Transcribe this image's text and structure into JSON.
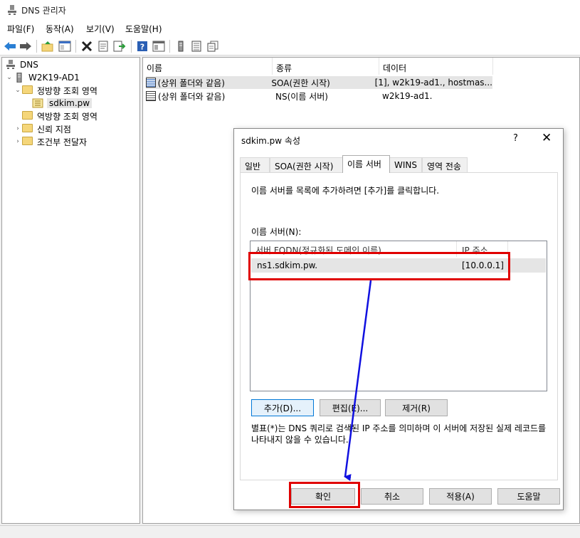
{
  "window": {
    "title": "DNS 관리자"
  },
  "menu": [
    "파일(F)",
    "동작(A)",
    "보기(V)",
    "도움말(H)"
  ],
  "toolbar": {
    "icons": [
      "back-icon",
      "forward-icon",
      "up-folder-icon",
      "console-tree-icon",
      "delete-icon",
      "properties-icon",
      "export-icon",
      "help-icon",
      "view-icon",
      "server-icon",
      "record-icon",
      "copy-icon"
    ]
  },
  "tree": {
    "root": "DNS",
    "server": "W2K19-AD1",
    "forward_zones": "정방향 조회 영역",
    "zone": "sdkim.pw",
    "reverse_zones": "역방향 조회 영역",
    "trust_points": "신뢰 지점",
    "conditional_forwarders": "조건부 전달자"
  },
  "list": {
    "columns": [
      "이름",
      "종류",
      "데이터"
    ],
    "rows": [
      {
        "name": "(상위 폴더와 같음)",
        "type": "SOA(권한 시작)",
        "data": "[1], w2k19-ad1., hostmas..."
      },
      {
        "name": "(상위 폴더와 같음)",
        "type": "NS(이름 서버)",
        "data": "w2k19-ad1."
      }
    ]
  },
  "dialog": {
    "title": "sdkim.pw 속성",
    "help": "?",
    "close": "✕",
    "tabs": [
      "일반",
      "SOA(권한 시작)",
      "이름 서버",
      "WINS",
      "영역 전송"
    ],
    "active_tab": "이름 서버",
    "instruction": "이름 서버를 목록에 추가하려면 [추가]를 클릭합니다.",
    "ns_label": "이름 서버(N):",
    "ns_columns": [
      "서버 FQDN(정규화된 도메인 이름)",
      "IP 주소"
    ],
    "ns_rows": [
      {
        "fqdn": "ns1.sdkim.pw.",
        "ip": "[10.0.0.1]"
      }
    ],
    "buttons": {
      "add": "추가(D)...",
      "edit": "편집(E)...",
      "remove": "제거(R)"
    },
    "note": "별표(*)는 DNS 쿼리로 검색된 IP 주소를 의미하며 이 서버에 저장된 실제 레코드를 나타내지 않을 수 있습니다.",
    "footer": {
      "ok": "확인",
      "cancel": "취소",
      "apply": "적용(A)",
      "help": "도움말"
    }
  },
  "colors": {
    "highlight": "#e00000",
    "arrow": "#1010e0",
    "accent": "#0078d7"
  }
}
